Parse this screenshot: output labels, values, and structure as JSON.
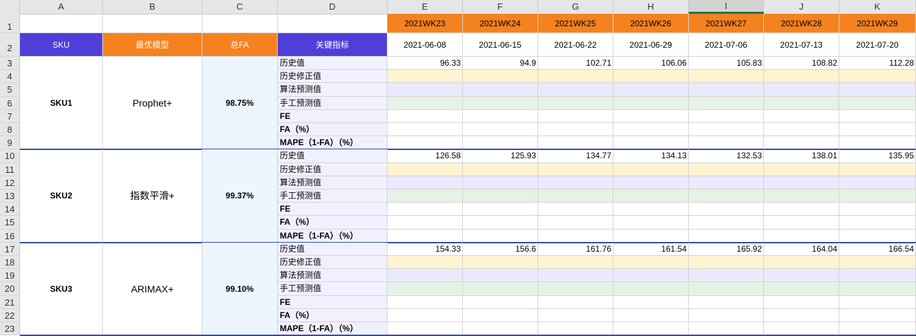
{
  "columns": [
    "A",
    "B",
    "C",
    "D",
    "E",
    "F",
    "G",
    "H",
    "I",
    "J",
    "K"
  ],
  "selected_column": "I",
  "rows": [
    "1",
    "2",
    "3",
    "4",
    "5",
    "6",
    "7",
    "8",
    "9",
    "10",
    "11",
    "12",
    "13",
    "14",
    "15",
    "16",
    "17",
    "18",
    "19",
    "20",
    "21",
    "22",
    "23"
  ],
  "header": {
    "sku": "SKU",
    "model": "最优模型",
    "fa": "总FA",
    "metric": "关键指标"
  },
  "weeks": [
    "2021WK23",
    "2021WK24",
    "2021WK25",
    "2021WK26",
    "2021WK27",
    "2021WK28",
    "2021WK29"
  ],
  "dates": [
    "2021-06-08",
    "2021-06-15",
    "2021-06-22",
    "2021-06-29",
    "2021-07-06",
    "2021-07-13",
    "2021-07-20"
  ],
  "metrics": [
    "历史值",
    "历史修正值",
    "算法预测值",
    "手工预测值",
    "FE",
    "FA（%）",
    "MAPE（1-FA）（%）"
  ],
  "skus": [
    {
      "name": "SKU1",
      "model": "Prophet+",
      "fa": "98.75%",
      "history": [
        "96.33",
        "94.9",
        "102.71",
        "106.06",
        "105.83",
        "108.82",
        "112.28"
      ]
    },
    {
      "name": "SKU2",
      "model": "指数平滑+",
      "fa": "99.37%",
      "history": [
        "126.58",
        "125.93",
        "134.77",
        "134.13",
        "132.53",
        "138.01",
        "135.95"
      ]
    },
    {
      "name": "SKU3",
      "model": "ARIMAX+",
      "fa": "99.10%",
      "history": [
        "154.33",
        "156.6",
        "161.76",
        "161.54",
        "165.92",
        "164.04",
        "166.54"
      ]
    }
  ],
  "colors": {
    "orange": "#f5821f",
    "blue_header": "#4f3fd8",
    "group_border": "#2f4ea6",
    "revised_fill": "#fff3d0",
    "algo_fill": "#ece9fd",
    "manual_fill": "#e6f2e6"
  }
}
